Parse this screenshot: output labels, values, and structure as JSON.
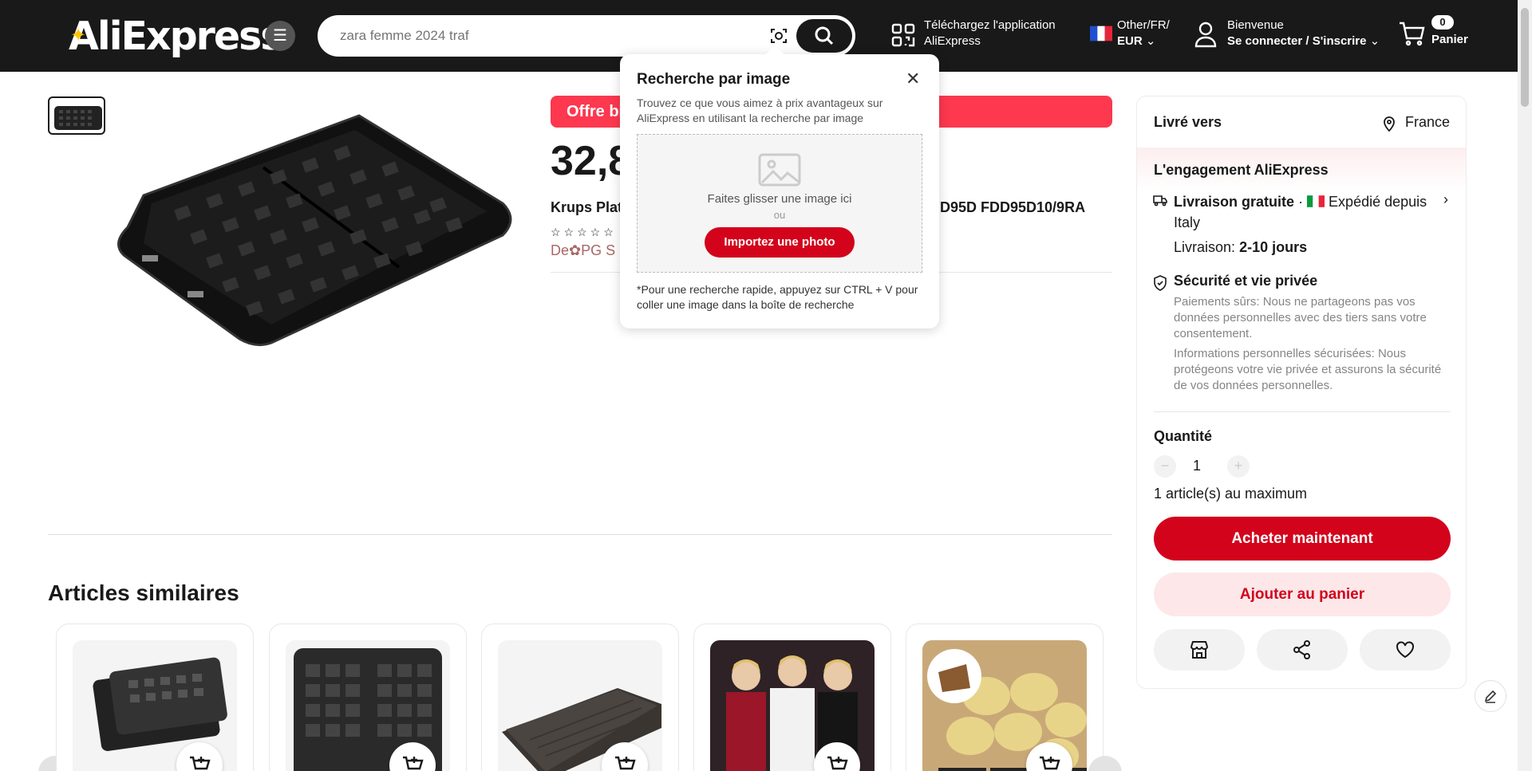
{
  "header": {
    "logo": "AliExpress",
    "search_placeholder": "zara femme 2024 traf",
    "app_line1": "Téléchargez l'application",
    "app_line2": "AliExpress",
    "lang_line1": "Other/FR/",
    "lang_line2": "EUR",
    "user_line1": "Bienvenue",
    "user_line2": "Se connecter / S'inscrire",
    "cart_count": "0",
    "cart_label": "Panier"
  },
  "product": {
    "offer_text": "Offre bi",
    "price": "32,8",
    "title_left": "Krups Plat",
    "title_right": "D95D FDD95D10/9RA",
    "stars": "☆☆☆☆☆",
    "store": "De✿PG S"
  },
  "similar": {
    "title": "Articles similaires"
  },
  "panel": {
    "ship_to_label": "Livré vers",
    "ship_country": "France",
    "engagement": "L'engagement AliExpress",
    "free_delivery": "Livraison gratuite",
    "shipped_from": "Expédié depuis",
    "shipped_country": "Italy",
    "delivery_label": "Livraison:",
    "delivery_days": "2-10 jours",
    "security_title": "Sécurité et vie privée",
    "security_text1": "Paiements sûrs: Nous ne partageons pas vos données personnelles avec des tiers sans votre consentement.",
    "security_text2": "Informations personnelles sécurisées: Nous protégeons votre vie privée et assurons la sécurité de vos données personnelles.",
    "qty_label": "Quantité",
    "qty_value": "1",
    "qty_max": "1 article(s) au maximum",
    "buy_now": "Acheter maintenant",
    "add_to_cart": "Ajouter au panier"
  },
  "popup": {
    "title": "Recherche par image",
    "description": "Trouvez ce que vous aimez à prix avantageux sur AliExpress en utilisant la recherche par image",
    "drop_text": "Faites glisser une image ici",
    "or_text": "ou",
    "upload_button": "Importez une photo",
    "tip": "*Pour une recherche rapide, appuyez sur CTRL + V pour coller une image dans la boîte de recherche"
  },
  "colors": {
    "accent": "#d3031c",
    "offer": "#fd384f",
    "header_bg": "#191919",
    "logo_accent": "#ffc400"
  }
}
